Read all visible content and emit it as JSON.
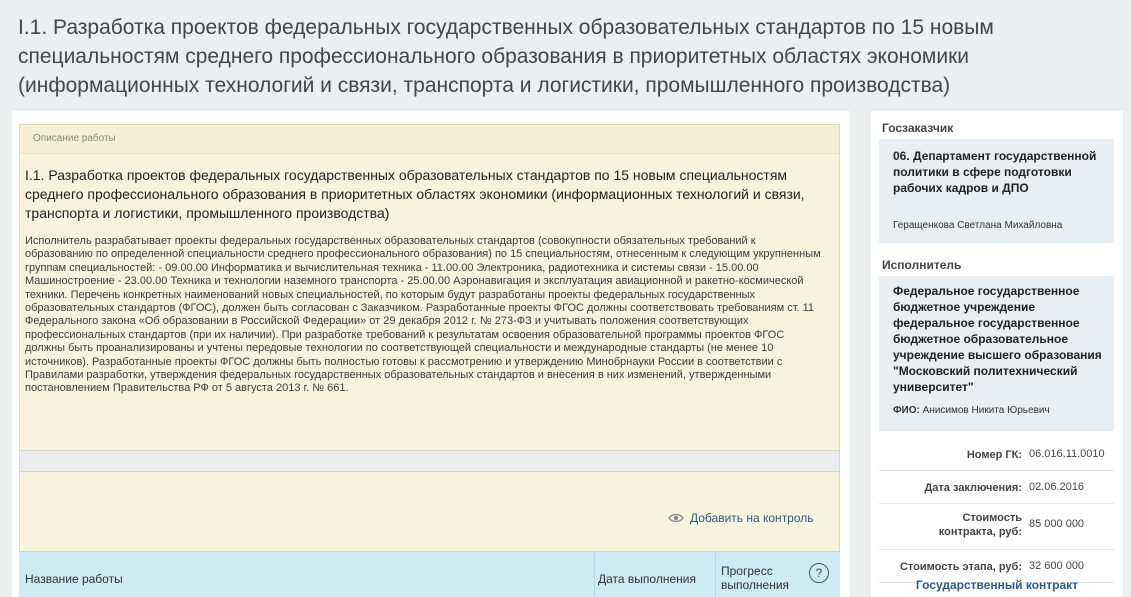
{
  "page": {
    "title": "I.1. Разработка проектов федеральных государственных образовательных стандартов по 15 новым специальностям среднего профессионального образования в приоритетных областях экономики (информационных технологий и связи, транспорта и логистики, промышленного производства)"
  },
  "description": {
    "header": "Описание работы",
    "title": "I.1. Разработка проектов федеральных государственных образовательных стандартов по 15 новым специальностям среднего профессионального образования в приоритетных областях экономики (информационных технологий и связи, транспорта и логистики, промышленного производства)",
    "text": "Исполнитель разрабатывает проекты федеральных государственных образовательных стандартов (совокупности обязательных требований к образованию по определенной специальности среднего профессионального образования) по 15 специальностям, отнесенным к следующим укрупненным группам специальностей: - 09.00.00 Информатика и вычислительная техника - 11.00.00 Электроника, радиотехника и системы связи - 15.00.00 Машиностроение - 23.00.00 Техника и технологии наземного транспорта - 25.00.00 Аэронавигация и эксплуатация авиационной и ракетно-космической техники. Перечень конкретных наименований новых специальностей, по которым будут разработаны проекты федеральных государственных образовательных стандартов (ФГОС), должен быть согласован с Заказчиком. Разработанные проекты ФГОС должны соответствовать требованиям ст. 11 Федерального закона «Об образовании в Российской Федерации» от 29 декабря 2012 г. № 273-ФЗ и учитывать положения соответствующих профессиональных стандартов (при их наличии). При разработке требований к результатам освоения образовательной программы проектов ФГОС должны быть проанализированы и учтены передовые технологии по соответствующей специальности и международные стандарты (не менее 10 источников). Разработанные проекты ФГОС должны быть полностью готовы к рассмотрению и утверждению Минобрнауки России в соответствии с Правилами разработки, утверждения федеральных государственных образовательных стандартов и внесения в них изменений, утвержденными постановлением Правительства РФ от 5 августа 2013 г. № 661."
  },
  "actions": {
    "watch_label": "Добавить на контроль"
  },
  "table": {
    "columns": [
      "Название работы",
      "Дата выполнения",
      "Прогресс выполнения"
    ],
    "help_symbol": "?"
  },
  "sidebar": {
    "customer_label": "Госзаказчик",
    "customer_name": "06. Департамент государственной политики в сфере подготовки рабочих кадров и ДПО",
    "customer_person": "Геращенкова Светлана Михайловна",
    "executor_label": "Исполнитель",
    "executor_name": "Федеральное государственное бюджетное учреждение федеральное государственное бюджетное образовательное учреждение высшего образования \"Московский политехнический университет\"",
    "executor_fio_label": "ФИО:",
    "executor_fio": "Анисимов Никита Юрьевич",
    "info": [
      {
        "label": "Номер ГК:",
        "value": "06.016.11.0010"
      },
      {
        "label": "Дата заключения:",
        "value": "02.06.2016"
      },
      {
        "label": "Стоимость контракта, руб:",
        "value": "85 000 000"
      },
      {
        "label": "Стоимость этапа, руб:",
        "value": "32 600 000"
      }
    ],
    "contract_link": "Государственный контракт"
  }
}
